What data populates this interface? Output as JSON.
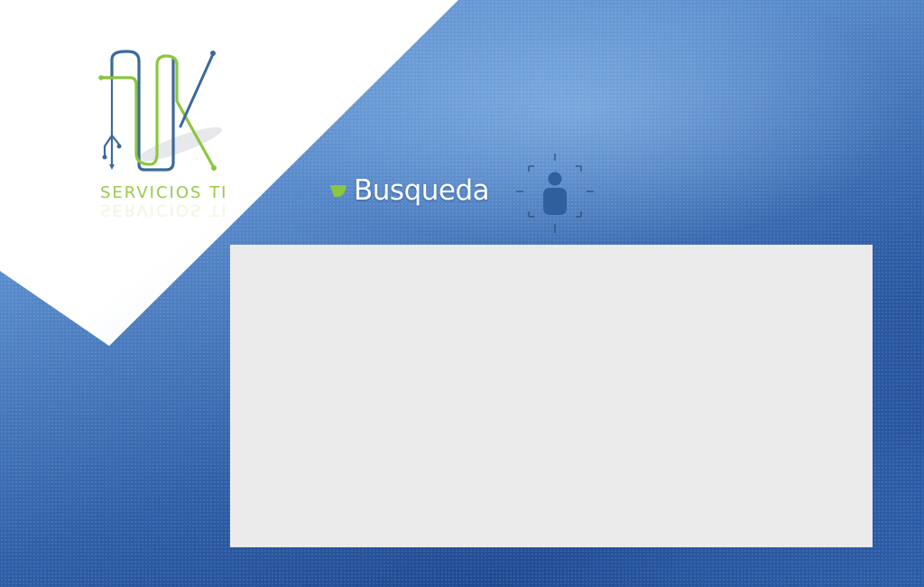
{
  "brand": {
    "tagline": "SERVICIOS TI"
  },
  "header": {
    "title": "Busqueda"
  },
  "icons": {
    "heading_bullet": "green-leaf-bullet-icon",
    "user": "user-target-icon"
  },
  "colors": {
    "accent_green": "#8cc63f",
    "logo_blue": "#3b6a9a",
    "background_blue": "#2f5ea6",
    "panel_gray": "#ecebec"
  },
  "content": {
    "panel": ""
  }
}
